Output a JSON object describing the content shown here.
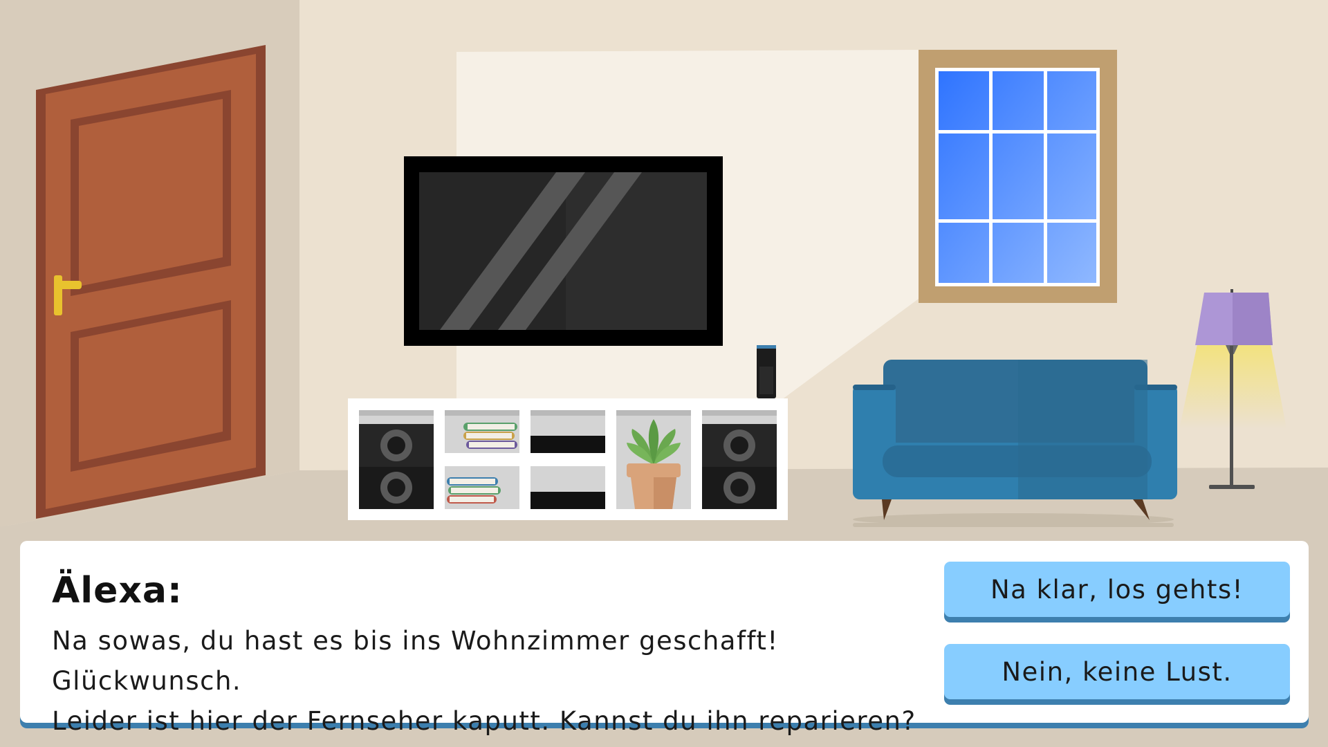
{
  "dialog": {
    "speaker": "Älexa:",
    "message_line1": "Na sowas, du hast es bis ins Wohnzimmer geschafft! Glückwunsch.",
    "message_line2": "Leider ist hier der Fernseher kaputt. Kannst du ihn reparieren?",
    "choices": [
      {
        "label": "Na klar, los gehts!"
      },
      {
        "label": "Nein, keine Lust."
      }
    ]
  },
  "scene": {
    "colors": {
      "wall": "#ece1d0",
      "floor": "#d6cbbb",
      "door": "#b05f3c",
      "door_frame": "#8a4530",
      "door_handle": "#e8c22e",
      "tv": "#262626",
      "sky": "#5a98ff",
      "window_frame": "#c09f70",
      "sofa": "#2f7fae",
      "lamp_shade": "#ad96d6",
      "accent_blue": "#3d7fae"
    },
    "icons": [
      "door-icon",
      "tv-icon",
      "window-icon",
      "smart-speaker-icon",
      "sofa-icon",
      "floor-lamp-icon",
      "plant-icon",
      "books-icon",
      "speaker-box-icon"
    ]
  }
}
